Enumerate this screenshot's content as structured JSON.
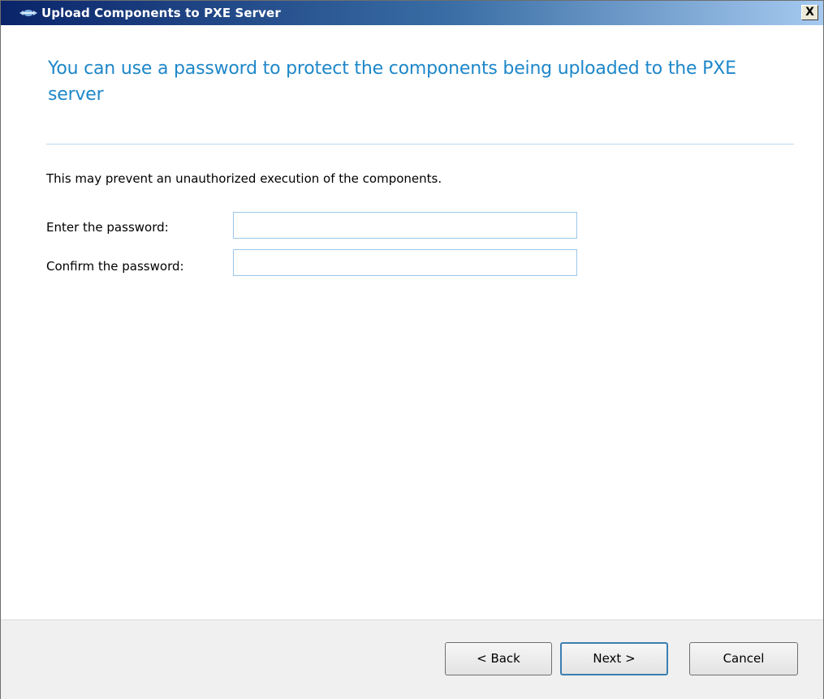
{
  "window": {
    "title": "Upload Components to PXE Server",
    "close_label": "X"
  },
  "main": {
    "heading": "You can use a password to protect the components being uploaded to the PXE server",
    "description": "This may prevent an unauthorized execution of the components.",
    "password_label": "Enter the password:",
    "password_value": "",
    "confirm_label": "Confirm the password:",
    "confirm_value": ""
  },
  "footer": {
    "back_label": "< Back",
    "next_label": "Next >",
    "cancel_label": "Cancel"
  },
  "colors": {
    "heading": "#1e87c9",
    "titlebar_start": "#0a246a",
    "titlebar_end": "#a6caf0"
  },
  "icons": {
    "title": "network-arrows-icon",
    "close": "close-icon"
  }
}
